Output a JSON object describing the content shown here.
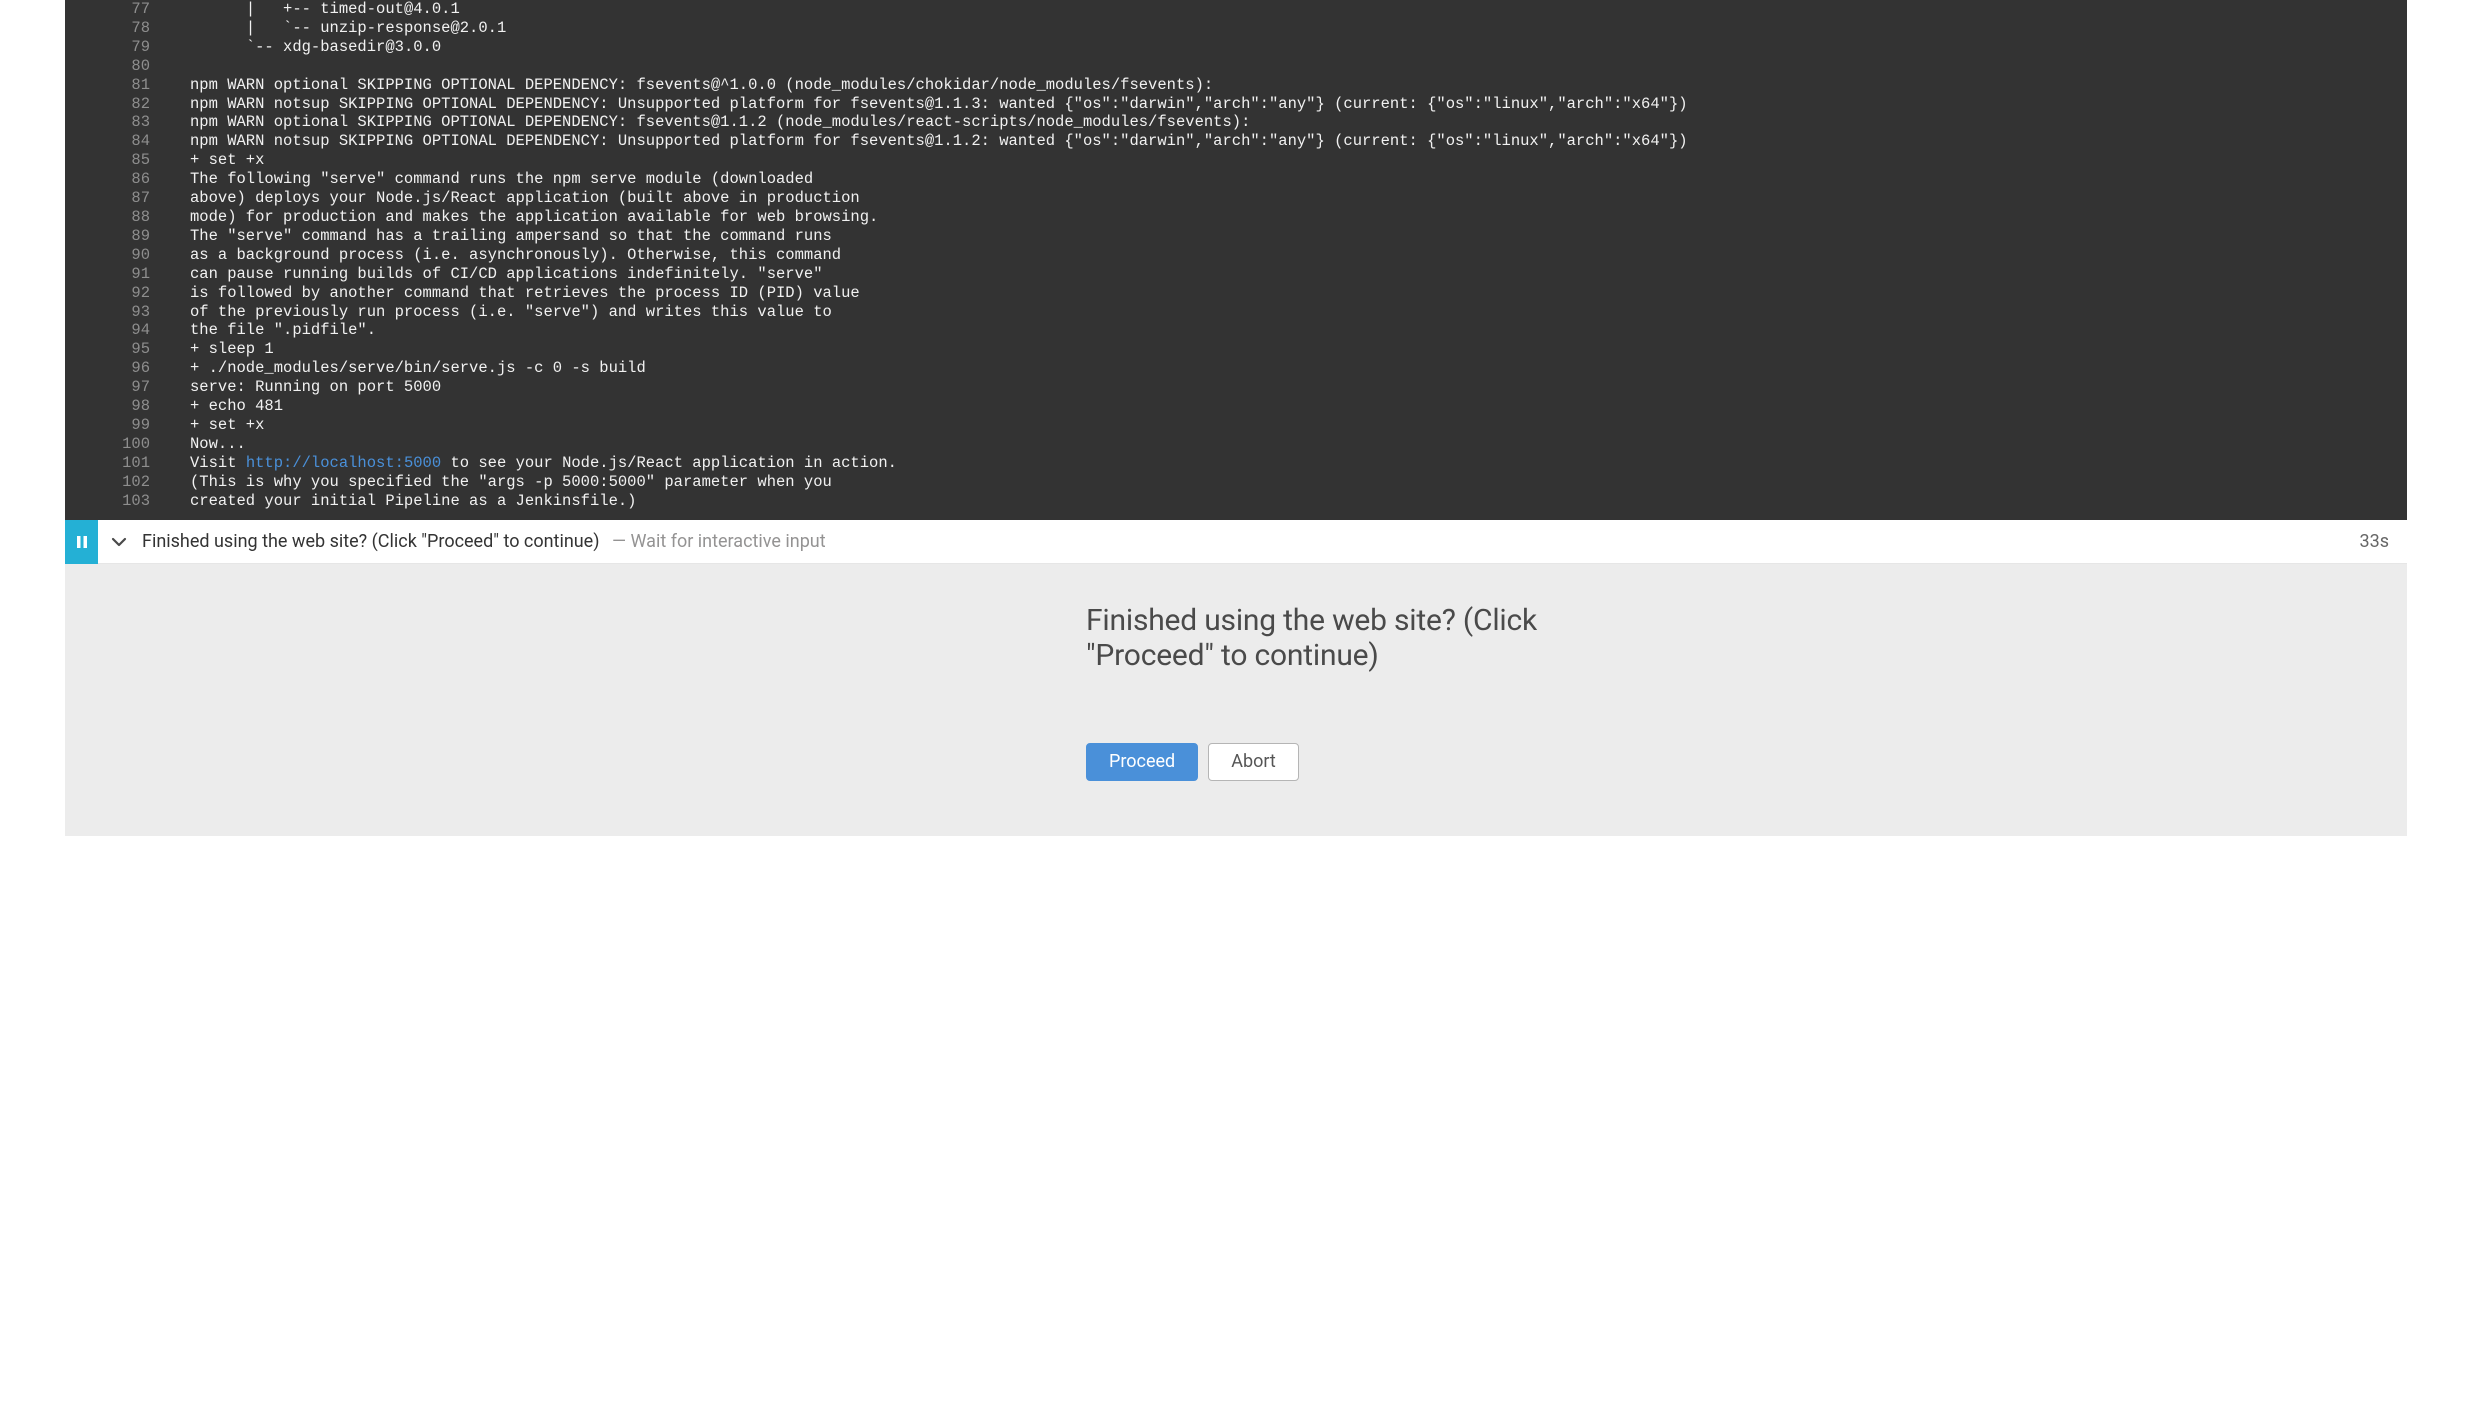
{
  "console": {
    "lines": [
      {
        "n": 77,
        "t": "      |   +-- timed-out@4.0.1"
      },
      {
        "n": 78,
        "t": "      |   `-- unzip-response@2.0.1"
      },
      {
        "n": 79,
        "t": "      `-- xdg-basedir@3.0.0"
      },
      {
        "n": 80,
        "t": ""
      },
      {
        "n": 81,
        "t": "npm WARN optional SKIPPING OPTIONAL DEPENDENCY: fsevents@^1.0.0 (node_modules/chokidar/node_modules/fsevents):"
      },
      {
        "n": 82,
        "t": "npm WARN notsup SKIPPING OPTIONAL DEPENDENCY: Unsupported platform for fsevents@1.1.3: wanted {\"os\":\"darwin\",\"arch\":\"any\"} (current: {\"os\":\"linux\",\"arch\":\"x64\"})"
      },
      {
        "n": 83,
        "t": "npm WARN optional SKIPPING OPTIONAL DEPENDENCY: fsevents@1.1.2 (node_modules/react-scripts/node_modules/fsevents):"
      },
      {
        "n": 84,
        "t": "npm WARN notsup SKIPPING OPTIONAL DEPENDENCY: Unsupported platform for fsevents@1.1.2: wanted {\"os\":\"darwin\",\"arch\":\"any\"} (current: {\"os\":\"linux\",\"arch\":\"x64\"})"
      },
      {
        "n": 85,
        "t": "+ set +x"
      },
      {
        "n": 86,
        "t": "The following \"serve\" command runs the npm serve module (downloaded"
      },
      {
        "n": 87,
        "t": "above) deploys your Node.js/React application (built above in production"
      },
      {
        "n": 88,
        "t": "mode) for production and makes the application available for web browsing."
      },
      {
        "n": 89,
        "t": "The \"serve\" command has a trailing ampersand so that the command runs"
      },
      {
        "n": 90,
        "t": "as a background process (i.e. asynchronously). Otherwise, this command"
      },
      {
        "n": 91,
        "t": "can pause running builds of CI/CD applications indefinitely. \"serve\""
      },
      {
        "n": 92,
        "t": "is followed by another command that retrieves the process ID (PID) value"
      },
      {
        "n": 93,
        "t": "of the previously run process (i.e. \"serve\") and writes this value to"
      },
      {
        "n": 94,
        "t": "the file \".pidfile\"."
      },
      {
        "n": 95,
        "t": "+ sleep 1"
      },
      {
        "n": 96,
        "t": "+ ./node_modules/serve/bin/serve.js -c 0 -s build"
      },
      {
        "n": 97,
        "t": "serve: Running on port 5000"
      },
      {
        "n": 98,
        "t": "+ echo 481"
      },
      {
        "n": 99,
        "t": "+ set +x"
      },
      {
        "n": 100,
        "t": "Now..."
      },
      {
        "n": 101,
        "t": "Visit ",
        "link": "http://localhost:5000",
        "after": " to see your Node.js/React application in action."
      },
      {
        "n": 102,
        "t": "(This is why you specified the \"args -p 5000:5000\" parameter when you"
      },
      {
        "n": 103,
        "t": "created your initial Pipeline as a Jenkinsfile.)"
      }
    ]
  },
  "step": {
    "status_color": "#24b0d5",
    "title": "Finished using the web site? (Click \"Proceed\" to continue)",
    "separator": "—",
    "subtitle": "Wait for interactive input",
    "duration": "33s"
  },
  "prompt": {
    "heading": "Finished using the web site? (Click \"Proceed\" to continue)",
    "proceed_label": "Proceed",
    "abort_label": "Abort"
  }
}
